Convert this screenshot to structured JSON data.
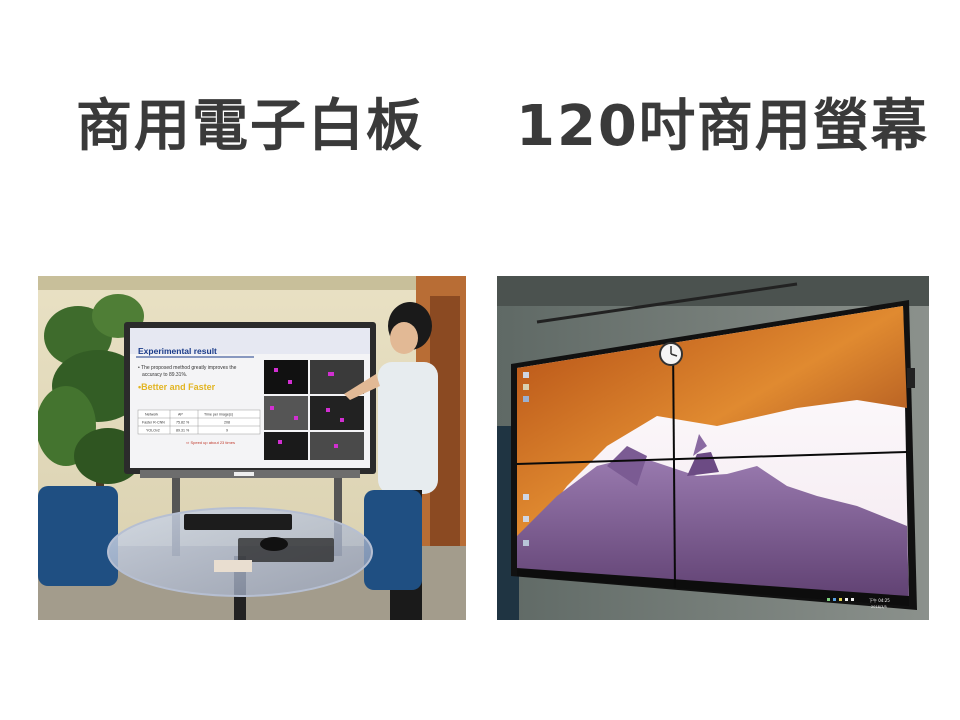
{
  "left_panel": {
    "title": "商用電子白板",
    "photo": {
      "slide_heading": "Experimental result",
      "slide_bullet_1": "• The proposed method greatly improves the",
      "slide_bullet_2": "accuracy to 89.31%.",
      "slide_highlight": "•Better and Faster",
      "table_headers": [
        "Network",
        "AP",
        "Time per image(s)"
      ],
      "table_rows": [
        [
          "Faster R-CNN",
          "75.82 %",
          "208"
        ],
        [
          "YOLOv2",
          "89.31 %",
          "9"
        ]
      ],
      "slide_note": "⇨ Speed up about 23 times"
    }
  },
  "right_panel": {
    "title": "120吋商用螢幕",
    "photo": {
      "taskbar_time": "下午 04:25",
      "taskbar_date": "2018/3/5"
    }
  }
}
